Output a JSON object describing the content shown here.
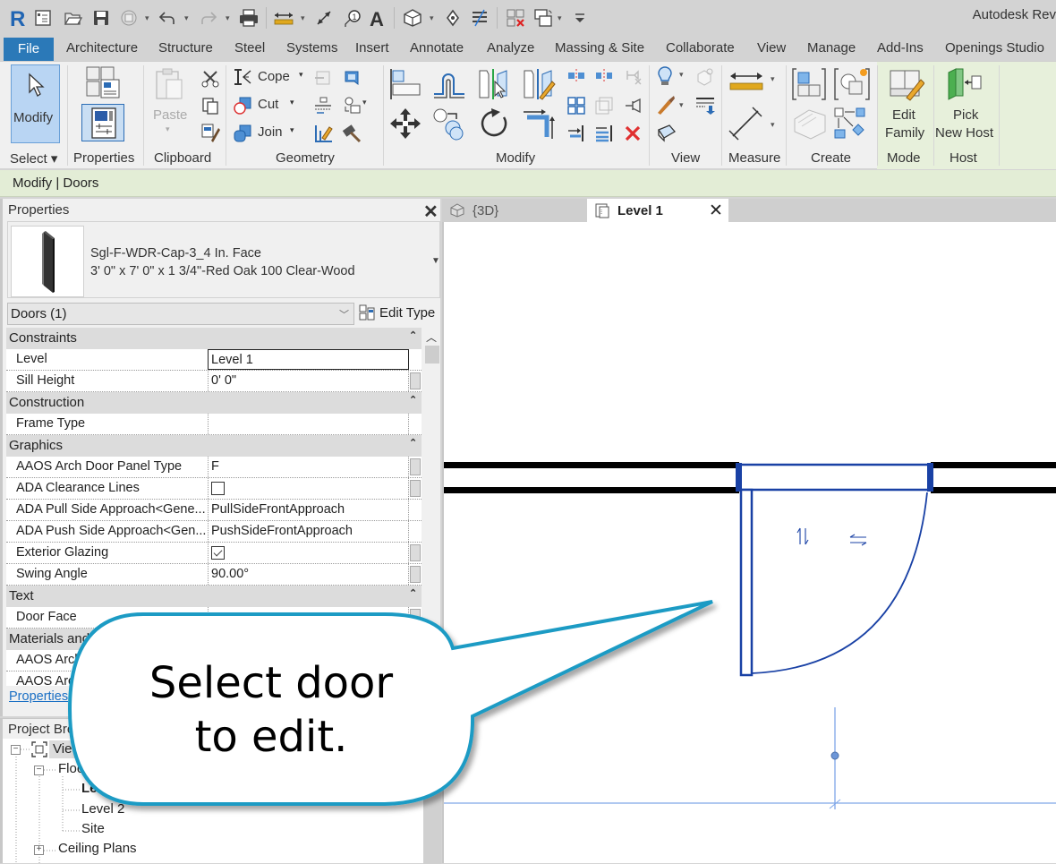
{
  "app": {
    "title": "Autodesk Rev"
  },
  "quick_access": {
    "icons": [
      "revit-logo-icon",
      "project-browser-icon",
      "open-icon",
      "save-icon",
      "sync-icon",
      "undo-icon",
      "redo-icon",
      "print-icon",
      "measure-icon",
      "aligned-dimension-icon",
      "tag-icon",
      "text-icon",
      "3d-view-icon",
      "section-icon",
      "thin-lines-icon",
      "close-hidden-icon",
      "switch-windows-icon",
      "customize-icon"
    ]
  },
  "ribbon_tabs": [
    "File",
    "Architecture",
    "Structure",
    "Steel",
    "Systems",
    "Insert",
    "Annotate",
    "Analyze",
    "Massing & Site",
    "Collaborate",
    "View",
    "Manage",
    "Add-Ins",
    "Openings Studio"
  ],
  "ribbon": {
    "select": {
      "button": "Modify",
      "label": "Select"
    },
    "properties": {
      "label": "Properties"
    },
    "clipboard": {
      "paste": "Paste",
      "label": "Clipboard"
    },
    "geometry": {
      "cope": "Cope",
      "cut": "Cut",
      "join": "Join",
      "label": "Geometry"
    },
    "modify": {
      "label": "Modify"
    },
    "view": {
      "label": "View"
    },
    "measure": {
      "label": "Measure"
    },
    "create": {
      "label": "Create"
    },
    "mode": {
      "button_line1": "Edit",
      "button_line2": "Family",
      "label": "Mode"
    },
    "host": {
      "button_line1": "Pick",
      "button_line2": "New Host",
      "label": "Host"
    }
  },
  "context_bar": {
    "text": "Modify | Doors"
  },
  "properties": {
    "title": "Properties",
    "type_name_line1": "Sgl-F-WDR-Cap-3_4 In. Face",
    "type_name_line2": "3' 0\" x 7' 0\" x 1 3/4\"-Red Oak 100 Clear-Wood",
    "instance_filter": "Doors (1)",
    "edit_type": "Edit Type",
    "groups": [
      {
        "name": "Constraints",
        "rows": [
          {
            "label": "Level",
            "value": "Level 1"
          },
          {
            "label": "Sill Height",
            "value": "0'  0\""
          }
        ]
      },
      {
        "name": "Construction",
        "rows": [
          {
            "label": "Frame Type",
            "value": ""
          }
        ]
      },
      {
        "name": "Graphics",
        "rows": [
          {
            "label": "AAOS Arch Door Panel Type",
            "value": "F"
          },
          {
            "label": "ADA Clearance Lines",
            "value": "",
            "checkbox": false
          },
          {
            "label": "ADA Pull Side Approach<Gene...",
            "value": "PullSideFrontApproach"
          },
          {
            "label": "ADA Push Side Approach<Gen...",
            "value": "PushSideFrontApproach"
          },
          {
            "label": "Exterior Glazing",
            "value": "",
            "checkbox": true
          },
          {
            "label": "Swing Angle",
            "value": "90.00°"
          }
        ]
      },
      {
        "name": "Text",
        "rows": [
          {
            "label": "Door Face",
            "value": ""
          }
        ]
      },
      {
        "name": "Materials and Fi",
        "rows": [
          {
            "label": "AAOS Arch",
            "value": ""
          },
          {
            "label": "AAOS Arc",
            "value": ""
          }
        ]
      }
    ],
    "help_link": "Properties"
  },
  "project_browser": {
    "title": "Project Bro",
    "items": [
      {
        "label": "View",
        "expander": "minus",
        "level": 0
      },
      {
        "label": "Floor",
        "expander": "minus",
        "level": 1
      },
      {
        "label": "Leve",
        "level": 2,
        "bold": true
      },
      {
        "label": "Level 2",
        "level": 2
      },
      {
        "label": "Site",
        "level": 2
      },
      {
        "label": "Ceiling Plans",
        "expander": "plus",
        "level": 1
      }
    ]
  },
  "view_tabs": [
    {
      "label": "{3D}",
      "active": false
    },
    {
      "label": "Level 1",
      "active": true
    }
  ],
  "callout": {
    "line1": "Select door",
    "line2": "to edit.",
    "border_color": "#1d9bc4"
  },
  "colors": {
    "selection_blue": "#1941a5",
    "file_tab": "#2b79b8",
    "context_green": "#e3edd6",
    "reference_line": "#7fa6e8"
  }
}
